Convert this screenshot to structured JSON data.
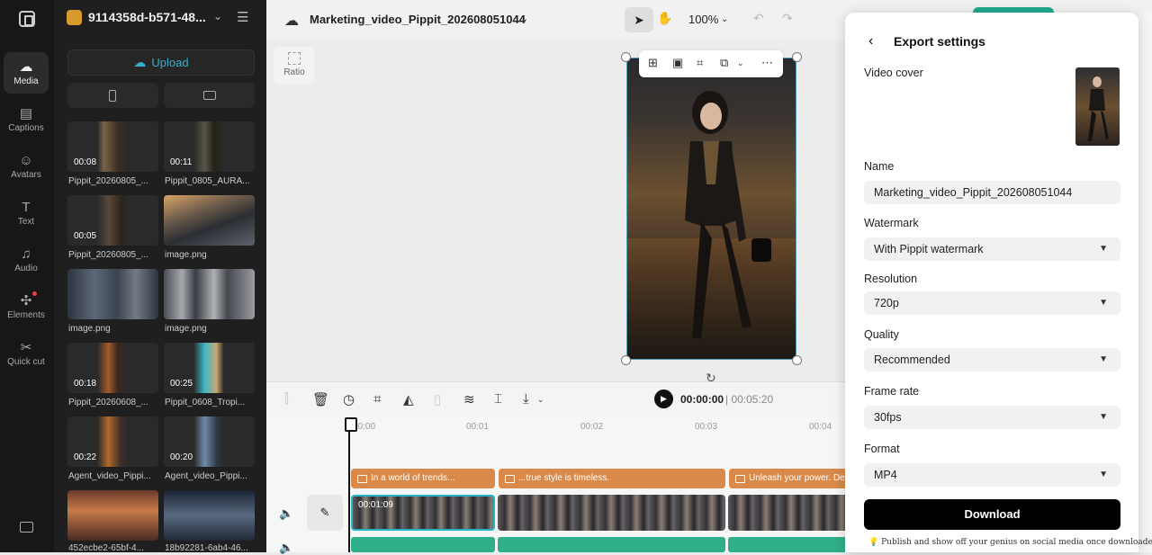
{
  "nav": {
    "items": [
      {
        "label": "Media",
        "icon": "cloud-icon",
        "glyph": "☁"
      },
      {
        "label": "Captions",
        "icon": "captions-icon",
        "glyph": "▤"
      },
      {
        "label": "Avatars",
        "icon": "avatar-icon",
        "glyph": "☺"
      },
      {
        "label": "Text",
        "icon": "text-icon",
        "glyph": "T"
      },
      {
        "label": "Audio",
        "icon": "music-icon",
        "glyph": "♫"
      },
      {
        "label": "Elements",
        "icon": "elements-icon",
        "glyph": "✣"
      },
      {
        "label": "Quick cut",
        "icon": "scissors-icon",
        "glyph": "✂"
      }
    ]
  },
  "media": {
    "project_name": "9114358d-b571-48...",
    "upload_label": "Upload",
    "items": [
      {
        "duration": "00:08",
        "name": "Pippit_20260805_..."
      },
      {
        "duration": "00:11",
        "name": "Pippit_0805_AURA..."
      },
      {
        "duration": "00:05",
        "name": "Pippit_20260805_..."
      },
      {
        "duration": "",
        "name": "image.png"
      },
      {
        "duration": "",
        "name": "image.png"
      },
      {
        "duration": "",
        "name": "image.png"
      },
      {
        "duration": "00:18",
        "name": "Pippit_20260608_..."
      },
      {
        "duration": "00:25",
        "name": "Pippit_0608_Tropi..."
      },
      {
        "duration": "00:22",
        "name": "Agent_video_Pippi..."
      },
      {
        "duration": "00:20",
        "name": "Agent_video_Pippi..."
      },
      {
        "duration": "",
        "name": "452ecbe2-65bf-4..."
      },
      {
        "duration": "",
        "name": "18b92281-6ab4-46..."
      }
    ]
  },
  "topbar": {
    "file_name": "Marketing_video_Pippit_202608051044",
    "zoom": "100%"
  },
  "canvas": {
    "ratio_label": "Ratio"
  },
  "timeline": {
    "current_time": "00:00:00",
    "total_time": "00:05:20",
    "ruler": [
      "00:00",
      "00:01",
      "00:02",
      "00:03",
      "00:04"
    ],
    "captions": [
      "In a world of trends...",
      "...true style is timeless.",
      "Unleash your power. De..."
    ],
    "clip_time": "00:01:09"
  },
  "export": {
    "title": "Export settings",
    "video_cover_label": "Video cover",
    "name_label": "Name",
    "name_value": "Marketing_video_Pippit_202608051044",
    "watermark_label": "Watermark",
    "watermark_value": "With Pippit watermark",
    "resolution_label": "Resolution",
    "resolution_value": "720p",
    "quality_label": "Quality",
    "quality_value": "Recommended",
    "framerate_label": "Frame rate",
    "framerate_value": "30fps",
    "format_label": "Format",
    "format_value": "MP4",
    "download_label": "Download",
    "tip": "Publish and show off your genius on social media once downloaded."
  },
  "colors": {
    "accent": "#35b0c9",
    "export_button": "#1fa98d",
    "caption_track": "#d98a4a",
    "audio_track": "#2fae8a",
    "download_button": "#000000"
  }
}
